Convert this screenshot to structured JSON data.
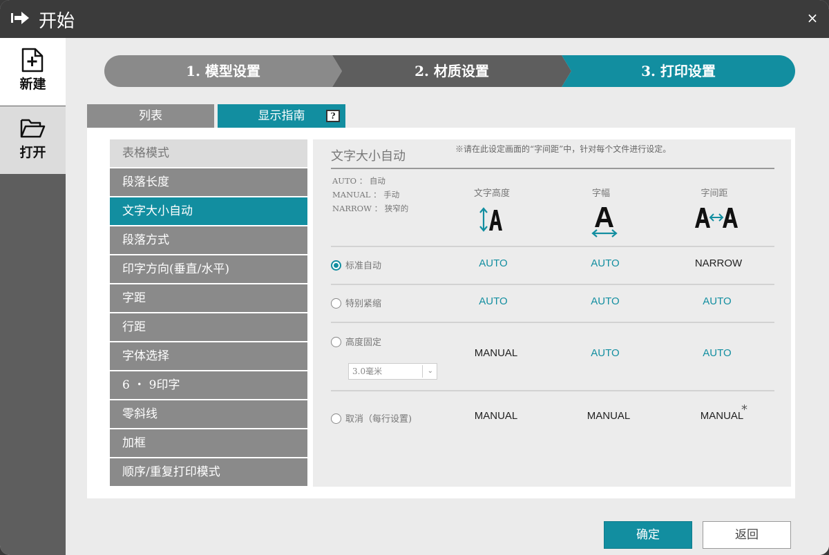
{
  "window": {
    "title": "开始",
    "close_glyph": "×"
  },
  "leftbar": {
    "new_label": "新建",
    "open_label": "打开"
  },
  "steps": [
    {
      "label": "1. 模型设置",
      "state": "done"
    },
    {
      "label": "2. 材质设置",
      "state": "done"
    },
    {
      "label": "3. 打印设置",
      "state": "current"
    }
  ],
  "tabs": {
    "list": "列表",
    "guide": "显示指南",
    "help_glyph": "?"
  },
  "menu": {
    "items": [
      "表格模式",
      "段落长度",
      "文字大小自动",
      "段落方式",
      "印字方向(垂直/水平)",
      "字距",
      "行距",
      "字体选择",
      "6 ・ 9印字",
      "零斜线",
      "加框",
      "顺序/重复打印模式"
    ],
    "active_index": 2
  },
  "content": {
    "title": "文字大小自动",
    "note": "※请在此设定画面的“字间距”中，针对每个文件进行设定。",
    "legend": [
      "AUTO ： 自动",
      "MANUAL ： 手动",
      "NARROW ： 狭窄的"
    ],
    "columns": [
      "文字高度",
      "字幅",
      "字间距"
    ],
    "options": [
      {
        "label": "标准自动",
        "selected": true,
        "values": [
          "AUTO",
          "AUTO",
          "NARROW"
        ]
      },
      {
        "label": "特别紧缩",
        "selected": false,
        "values": [
          "AUTO",
          "AUTO",
          "AUTO"
        ]
      },
      {
        "label": "高度固定",
        "selected": false,
        "values": [
          "MANUAL",
          "AUTO",
          "AUTO"
        ]
      },
      {
        "label": "取消（每行设置)",
        "selected": false,
        "values": [
          "MANUAL",
          "MANUAL",
          "MANUAL"
        ]
      }
    ],
    "height_select": "3.0毫米",
    "asterisk": "*"
  },
  "buttons": {
    "ok": "确定",
    "back": "返回"
  },
  "colors": {
    "accent": "#128ea0",
    "titlebar": "#3b3b3b"
  },
  "icons": {
    "title": "arrow-right-bar-icon",
    "new": "file-plus-icon",
    "open": "folder-open-icon",
    "help": "help-box-icon",
    "close": "close-icon",
    "chevron": "chevron-down-icon"
  }
}
